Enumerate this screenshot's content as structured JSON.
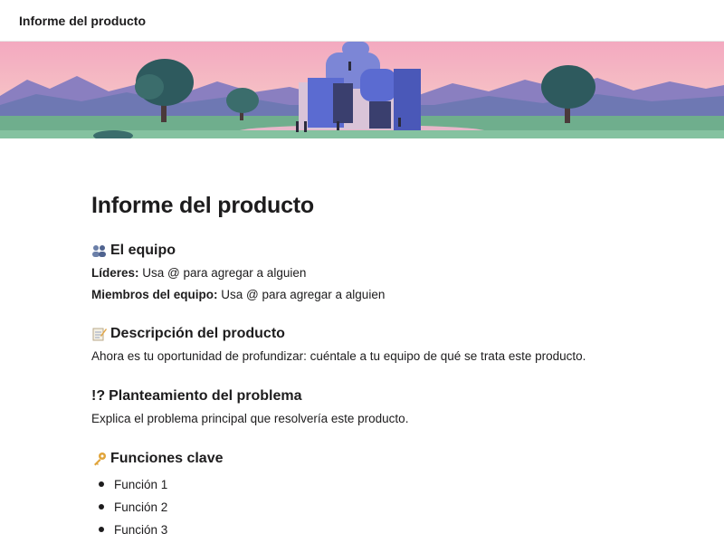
{
  "topbar": {
    "title": "Informe del producto"
  },
  "banner": {
    "illustration": "landscape-with-building-illustration",
    "sky_color": "#f2b3c4",
    "mountain_color": "#8a7fc0",
    "grass_color": "#6fae8d",
    "building_color": "#5b6bd1"
  },
  "document": {
    "title": "Informe del producto",
    "team": {
      "icon": "people-icon",
      "heading": "El equipo",
      "leaders_label": "Líderes:",
      "leaders_value": " Usa @ para agregar a alguien",
      "members_label": "Miembros del equipo:",
      "members_value": " Usa @ para agregar a alguien"
    },
    "description": {
      "icon": "memo-icon",
      "heading": "Descripción del producto",
      "text": "Ahora es tu oportunidad de profundizar: cuéntale a tu equipo de qué se trata este producto."
    },
    "problem": {
      "icon": "interrobang-icon",
      "icon_text": "!?",
      "heading": "Planteamiento del problema",
      "text": "Explica el problema principal que resolvería este producto."
    },
    "features": {
      "icon": "key-icon",
      "heading": "Funciones clave",
      "items": [
        "Función 1",
        "Función 2",
        "Función 3"
      ]
    }
  }
}
